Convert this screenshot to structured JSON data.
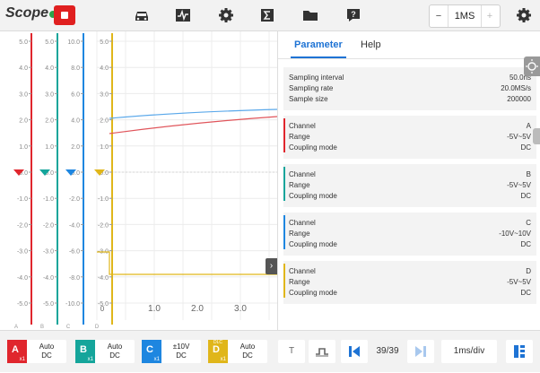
{
  "app": {
    "logo": "Scope"
  },
  "toolbar": {
    "icons": [
      "car-icon",
      "waveform-icon",
      "gear-icon",
      "sigma-icon",
      "folder-icon",
      "help-icon"
    ],
    "timebase": {
      "minus": "−",
      "value": "1MS",
      "plus": "+"
    }
  },
  "scope": {
    "axis_A": [
      "5.0",
      "4.0",
      "3.0",
      "2.0",
      "1.0",
      "0.0",
      "-1.0",
      "-2.0",
      "-3.0",
      "-4.0",
      "-5.0"
    ],
    "axis_B": [
      "5.0",
      "4.0",
      "3.0",
      "2.0",
      "1.0",
      "0.0",
      "-1.0",
      "-2.0",
      "-3.0",
      "-4.0",
      "-5.0"
    ],
    "axis_C": [
      "10.0",
      "8.0",
      "6.0",
      "4.0",
      "2.0",
      "0.0",
      "-2.0",
      "-4.0",
      "-6.0",
      "-8.0",
      "-10.0"
    ],
    "axis_D": [
      "5.0",
      "4.0",
      "3.0",
      "2.0",
      "1.0",
      "0.0",
      "-1.0",
      "-2.0",
      "-3.0",
      "-4.0",
      "-5.0"
    ],
    "channel_letters": [
      "A",
      "B",
      "C",
      "D"
    ],
    "time_labels": [
      "0",
      "1.0",
      "2.0",
      "3.0"
    ],
    "colors": {
      "A": "#e0262d",
      "B": "#15a59b",
      "C": "#1e86e0",
      "D": "#e0b61a"
    }
  },
  "parameter": {
    "tabs": {
      "parameter": "Parameter",
      "help": "Help"
    },
    "sampling": [
      {
        "k": "Sampling interval",
        "v": "50.0ns"
      },
      {
        "k": "Sampling rate",
        "v": "20.0MS/s"
      },
      {
        "k": "Sample size",
        "v": "200000"
      }
    ],
    "channels": [
      {
        "color": "#e0262d",
        "rows": [
          {
            "k": "Channel",
            "v": "A"
          },
          {
            "k": "Range",
            "v": "-5V~5V"
          },
          {
            "k": "Coupling mode",
            "v": "DC"
          }
        ]
      },
      {
        "color": "#15a59b",
        "rows": [
          {
            "k": "Channel",
            "v": "B"
          },
          {
            "k": "Range",
            "v": "-5V~5V"
          },
          {
            "k": "Coupling mode",
            "v": "DC"
          }
        ]
      },
      {
        "color": "#1e86e0",
        "rows": [
          {
            "k": "Channel",
            "v": "C"
          },
          {
            "k": "Range",
            "v": "-10V~10V"
          },
          {
            "k": "Coupling mode",
            "v": "DC"
          }
        ]
      },
      {
        "color": "#e0b61a",
        "rows": [
          {
            "k": "Channel",
            "v": "D"
          },
          {
            "k": "Range",
            "v": "-5V~5V"
          },
          {
            "k": "Coupling mode",
            "v": "DC"
          }
        ]
      }
    ]
  },
  "bottom": {
    "channels": [
      {
        "letter": "A",
        "mult": "x1",
        "line1": "Auto",
        "line2": "DC",
        "color": "#e0262d"
      },
      {
        "letter": "B",
        "mult": "x1",
        "line1": "Auto",
        "line2": "DC",
        "color": "#15a59b"
      },
      {
        "letter": "C",
        "mult": "x1",
        "line1": "±10V",
        "line2": "DC",
        "color": "#1e86e0"
      },
      {
        "letter": "D",
        "mult": "x1",
        "line1": "Auto",
        "line2": "DC",
        "color": "#e0b61a",
        "badge": "DLC"
      }
    ],
    "trigger_label": "T",
    "page": "39/39",
    "timediv": "1ms/div"
  }
}
